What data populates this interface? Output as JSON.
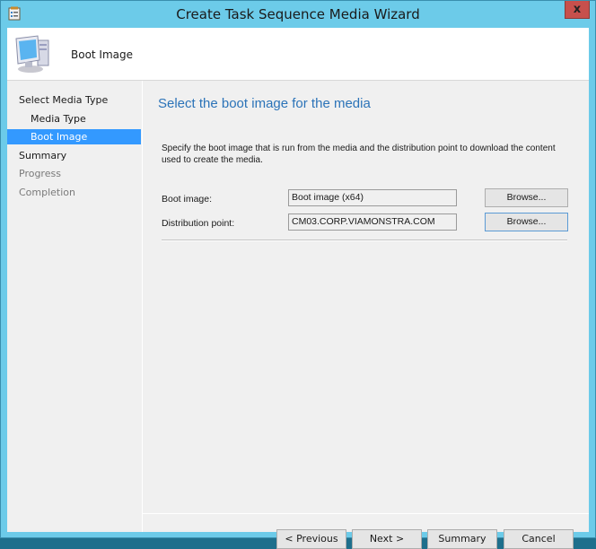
{
  "window": {
    "title": "Create Task Sequence Media Wizard",
    "close_label": "x",
    "app_icon": "wizard-app-icon"
  },
  "header": {
    "icon": "computer-icon",
    "title": "Boot Image"
  },
  "sidebar": {
    "items": [
      {
        "label": "Select Media Type",
        "level": "top",
        "state": "normal"
      },
      {
        "label": "Media Type",
        "level": "sub",
        "state": "normal"
      },
      {
        "label": "Boot Image",
        "level": "sub",
        "state": "active"
      },
      {
        "label": "Summary",
        "level": "top",
        "state": "normal"
      },
      {
        "label": "Progress",
        "level": "top",
        "state": "disabled"
      },
      {
        "label": "Completion",
        "level": "top",
        "state": "disabled"
      }
    ]
  },
  "main": {
    "title": "Select the boot image for the media",
    "description": "Specify the boot image that is run from the media and the distribution point to download the content used to create the media.",
    "fields": [
      {
        "label": "Boot image:",
        "value": "Boot image (x64)",
        "button": "Browse..."
      },
      {
        "label": "Distribution point:",
        "value": "CM03.CORP.VIAMONSTRA.COM",
        "button": "Browse..."
      }
    ]
  },
  "footer": {
    "previous": "< Previous",
    "next": "Next >",
    "summary": "Summary",
    "cancel": "Cancel"
  },
  "colors": {
    "frame": "#6ccbe9",
    "accent_title": "#2b73b8",
    "selection": "#3399ff",
    "close": "#c7504c"
  }
}
